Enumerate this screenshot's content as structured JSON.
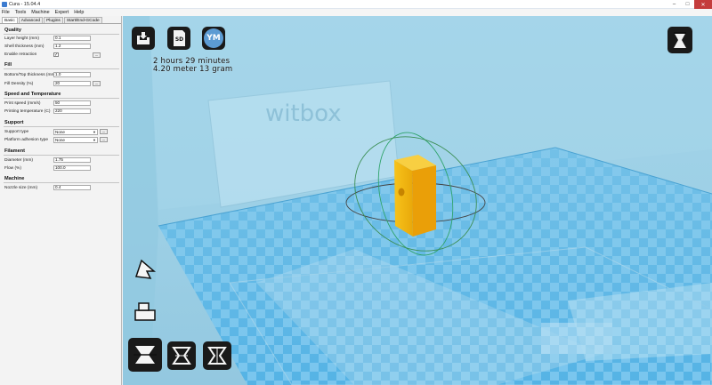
{
  "window": {
    "title": "Cura - 15.04.4",
    "controls": [
      "–",
      "□",
      "✕"
    ]
  },
  "menu": [
    "File",
    "Tools",
    "Machine",
    "Expert",
    "Help"
  ],
  "tabs": [
    "Basic",
    "Advanced",
    "Plugins",
    "Start/End-GCode"
  ],
  "active_tab": "Basic",
  "sections": {
    "quality": {
      "title": "Quality",
      "layer_height": {
        "label": "Layer height (mm)",
        "value": "0.1"
      },
      "shell_thickness": {
        "label": "Shell thickness (mm)",
        "value": "1.2"
      },
      "enable_retraction": {
        "label": "Enable retraction",
        "checked": "✓",
        "button": "..."
      }
    },
    "fill": {
      "title": "Fill",
      "bottom_top_thickness": {
        "label": "Bottom/Top thickness (mm)",
        "value": "1.0"
      },
      "fill_density": {
        "label": "Fill Density (%)",
        "value": "20",
        "button": "..."
      }
    },
    "speed": {
      "title": "Speed and Temperature",
      "print_speed": {
        "label": "Print speed (mm/s)",
        "value": "50"
      },
      "printing_temperature": {
        "label": "Printing temperature (C)",
        "value": "220"
      }
    },
    "support": {
      "title": "Support",
      "support_type": {
        "label": "Support type",
        "value": "None",
        "button": "..."
      },
      "platform_adhesion": {
        "label": "Platform adhesion type",
        "value": "None",
        "button": "..."
      }
    },
    "filament": {
      "title": "Filament",
      "diameter": {
        "label": "Diameter (mm)",
        "value": "1.75"
      },
      "flow": {
        "label": "Flow (%)",
        "value": "100.0"
      }
    },
    "machine": {
      "title": "Machine",
      "nozzle_size": {
        "label": "Nozzle size (mm)",
        "value": "0.4"
      }
    }
  },
  "viewport": {
    "toolbar_icons": [
      "load-model-icon",
      "save-to-sd-icon",
      "youmagine-icon"
    ],
    "youmagine_label": "YM",
    "sd_label": "SD",
    "estimate_line1": "2 hours 29 minutes",
    "estimate_line2": "4.20 meter 13 gram",
    "printer_logo": "witbox",
    "model_color": "#f2b80a",
    "bed_color": "#5ab6e6",
    "bottom_tools": [
      "rotate-icon",
      "scale-icon",
      "mirror-icon",
      "mirror-x-icon",
      "mirror-y-icon"
    ],
    "view_mode_icon": "view-mode-icon"
  }
}
